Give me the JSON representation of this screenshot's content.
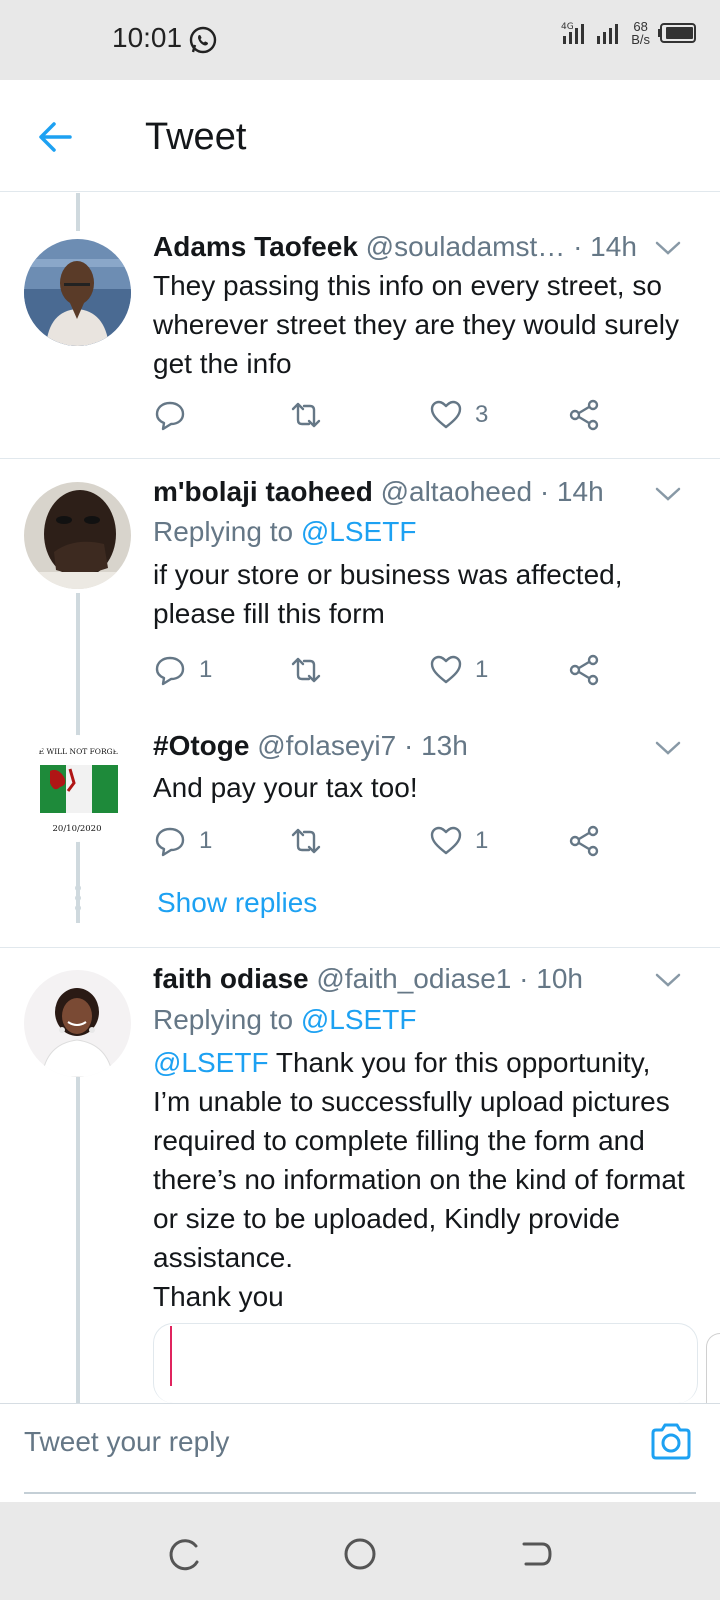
{
  "status_bar": {
    "time": "10:01",
    "net_speed_value": "68",
    "net_speed_unit": "B/s",
    "network_label": "4G"
  },
  "header": {
    "title": "Tweet"
  },
  "tweets": [
    {
      "name": "Adams Taofeek",
      "handle": "@souladamst…",
      "sep": "·",
      "time": "14h",
      "text": "They passing this info on every street, so wherever street they are they would surely get the info",
      "reply_count": "",
      "retweet_count": "",
      "like_count": "3"
    },
    {
      "name": "m'bolaji taoheed",
      "handle": "@altaoheed",
      "sep": "·",
      "time": "14h",
      "replying_prefix": "Replying to",
      "replying_to": "@LSETF",
      "text": "if your store or business was affected, please fill this form",
      "reply_count": "1",
      "retweet_count": "",
      "like_count": "1"
    },
    {
      "name": "#Otoge",
      "handle": "@folaseyi7",
      "sep": "·",
      "time": "13h",
      "avatar_top_text": "WE WILL NOT FORGET",
      "avatar_bottom_text": "20/10/2020",
      "text": "And pay your tax too!",
      "reply_count": "1",
      "retweet_count": "",
      "like_count": "1",
      "show_replies": "Show replies"
    },
    {
      "name": "faith odiase",
      "handle": "@faith_odiase1",
      "sep": "·",
      "time": "10h",
      "replying_prefix": "Replying to",
      "replying_to": "@LSETF",
      "text_mention": "@LSETF",
      "text": " Thank you for this opportunity, I’m unable to successfully upload pictures required to complete filling the form and there’s no information on the kind of format or size to be uploaded, Kindly provide assistance.",
      "text_line2": "Thank you"
    }
  ],
  "reply_bar": {
    "placeholder": "Tweet your reply"
  },
  "colors": {
    "accent": "#1da1f2",
    "secondary_text": "#657786",
    "like_red": "#e0245e"
  },
  "icons": [
    "back-arrow-icon",
    "chevron-down-icon",
    "reply-icon",
    "retweet-icon",
    "like-icon",
    "share-icon",
    "camera-icon",
    "whatsapp-icon",
    "signal-icon",
    "battery-icon"
  ]
}
